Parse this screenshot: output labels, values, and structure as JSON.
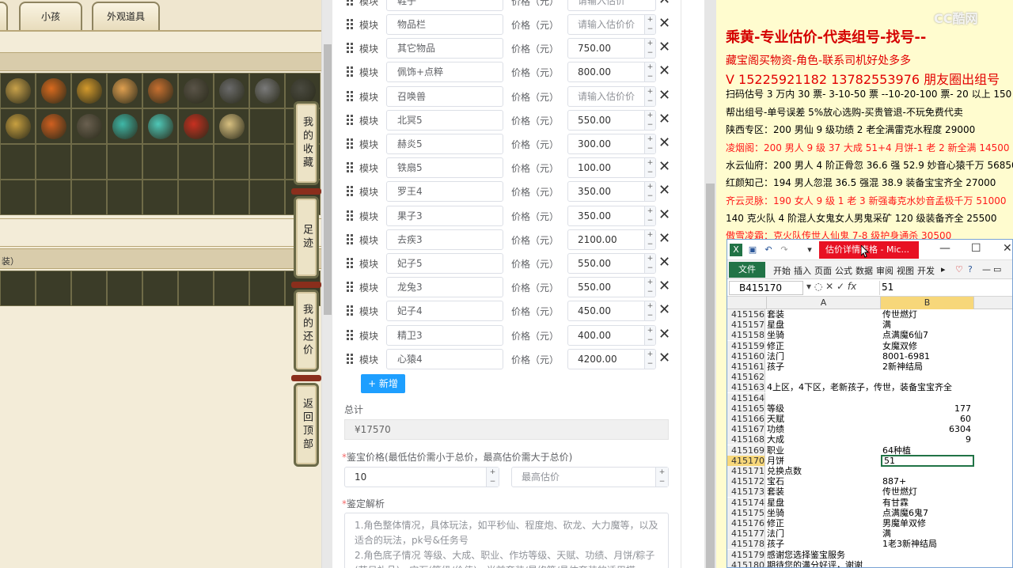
{
  "game": {
    "tabs": [
      "小孩",
      "外观道具"
    ],
    "strip_text": "装）",
    "side_buttons": [
      "我的收藏",
      "足迹",
      "我的还价",
      "返回顶部"
    ]
  },
  "form": {
    "cut_top_name": "鞋子",
    "cut_top_price": "请输入估价",
    "module_label": "模块",
    "price_label": "价格（元）",
    "rows": [
      {
        "name": "物品栏",
        "price": "请输入估价价",
        "placeholder": true
      },
      {
        "name": "其它物品",
        "price": "750.00",
        "placeholder": false
      },
      {
        "name": "佩饰+点粹",
        "price": "800.00",
        "placeholder": false
      },
      {
        "name": "召唤兽",
        "price": "请输入估价价",
        "placeholder": true
      },
      {
        "name": "北冥5",
        "price": "550.00",
        "placeholder": false
      },
      {
        "name": "赫炎5",
        "price": "300.00",
        "placeholder": false
      },
      {
        "name": "铁扇5",
        "price": "100.00",
        "placeholder": false
      },
      {
        "name": "罗王4",
        "price": "350.00",
        "placeholder": false
      },
      {
        "name": "果子3",
        "price": "350.00",
        "placeholder": false
      },
      {
        "name": "去疾3",
        "price": "2100.00",
        "placeholder": false
      },
      {
        "name": "妃子5",
        "price": "550.00",
        "placeholder": false
      },
      {
        "name": "龙兔3",
        "price": "550.00",
        "placeholder": false
      },
      {
        "name": "妃子4",
        "price": "450.00",
        "placeholder": false
      },
      {
        "name": "精卫3",
        "price": "400.00",
        "placeholder": false
      },
      {
        "name": "心猿4",
        "price": "4200.00",
        "placeholder": false
      }
    ],
    "add_button": "+ 新增",
    "total_label": "总计",
    "total_value": "¥17570",
    "jianbao_label": "鉴宝价格(最低估价需小于总价，最高估价需大于总价)",
    "min_price": "10",
    "max_placeholder": "最高估价",
    "jiexi_label": "鉴定解析",
    "jiexi_text_1": "1.角色整体情况，具体玩法，如平秒仙、程度炮、砍龙、大力魔等，以及适合的玩法，pk号&任务号",
    "jiexi_text_2": "2.角色底子情况 等级、大成、职业、作坊等级、天赋、功绩、月饼/粽子(节日礼品)、宝石(等级/价值)、当前套装/星修等/具体套装的适用搭"
  },
  "doc": {
    "line1": "乘黄-专业估价-代卖组号-找号--",
    "line2": "藏宝阁买物资-角色-联系司机好处多多",
    "line3": "V 15225921182   13782553976 朋友圈出组号",
    "line4": "扫码估号 3 万内 30 票- 3-10-50 票  --10-20-100 票- 20 以上 150",
    "line5": "帮出组号-单号误差 5%放心选购-买贵管退-不玩免费代卖",
    "line6": "陕西专区：200 男仙 9 级功绩 2 老全满雷克水程度 29000",
    "line7": "凌烟阁：200 男人 9 级 37 大成 51+4 月饼-1 老 2 新全满 14500",
    "line8": "水云仙府：200 男人 4 阶正骨忽 36.6 强 52.9 妙音心猿千万 56850",
    "line9": "红颜知己：194 男人忽混 36.5 强混 38.9 装备宝宝齐全 27000",
    "line10": "齐云灵脉：190 女人 9 级 1 老 3 新强毒克水妙音孟极千万 51000",
    "line11": "140 克火队 4 阶混人女鬼女人男鬼采矿 120 级装备齐全 25500",
    "line12": "傲雪凌霜：克火队传世人仙鬼 7-8 级护身通杀 30500",
    "watermark": "CC酷网"
  },
  "excel": {
    "title": "估价详情表格 - Mic...",
    "ribbon_file": "文件",
    "ribbon_tabs": [
      "开始",
      "插入",
      "页面",
      "公式",
      "数据",
      "审阅",
      "视图",
      "开发"
    ],
    "name_box": "B415170",
    "formula_value": "51",
    "col_a": "A",
    "col_b": "B",
    "rows": [
      {
        "n": "415156",
        "a": "套装",
        "b": "传世燃灯",
        "num": false
      },
      {
        "n": "415157",
        "a": "星盘",
        "b": "满",
        "num": false
      },
      {
        "n": "415158",
        "a": "坐骑",
        "b": "点满魔6仙7",
        "num": false
      },
      {
        "n": "415159",
        "a": "修正",
        "b": "女魔双修",
        "num": false
      },
      {
        "n": "415160",
        "a": "法门",
        "b": "8001-6981",
        "num": false
      },
      {
        "n": "415161",
        "a": "孩子",
        "b": "2新神结局",
        "num": false
      },
      {
        "n": "415162",
        "a": "",
        "b": "",
        "num": false
      },
      {
        "n": "415163",
        "a": "4上区，4下区，老新孩子，传世，装备宝宝齐全",
        "b": "",
        "num": false
      },
      {
        "n": "415164",
        "a": "",
        "b": "",
        "num": false
      },
      {
        "n": "415165",
        "a": "等级",
        "b": "177",
        "num": true
      },
      {
        "n": "415166",
        "a": "天赋",
        "b": "60",
        "num": true
      },
      {
        "n": "415167",
        "a": "功绩",
        "b": "6304",
        "num": true
      },
      {
        "n": "415168",
        "a": "大成",
        "b": "9",
        "num": true
      },
      {
        "n": "415169",
        "a": "职业",
        "b": "64种植",
        "num": false
      },
      {
        "n": "415170",
        "a": "月饼",
        "b": "51",
        "num": false,
        "selected": true
      },
      {
        "n": "415171",
        "a": "兑换点数",
        "b": "",
        "num": false
      },
      {
        "n": "415172",
        "a": "宝石",
        "b": "887+",
        "num": false
      },
      {
        "n": "415173",
        "a": "套装",
        "b": "传世燃灯",
        "num": false
      },
      {
        "n": "415174",
        "a": "星盘",
        "b": "有甘霖",
        "num": false
      },
      {
        "n": "415175",
        "a": "坐骑",
        "b": "点满魔6鬼7",
        "num": false
      },
      {
        "n": "415176",
        "a": "修正",
        "b": "男魔单双修",
        "num": false
      },
      {
        "n": "415177",
        "a": "法门",
        "b": "满",
        "num": false
      },
      {
        "n": "415178",
        "a": "孩子",
        "b": "1老3新神结局",
        "num": false
      },
      {
        "n": "415179",
        "a": "感谢您选择鉴宝服务",
        "b": "",
        "num": false
      },
      {
        "n": "415180",
        "a": "期待您的满分好评，谢谢",
        "b": "",
        "num": false
      }
    ]
  },
  "colors": {
    "accent_blue": "#1e9fff",
    "excel_green": "#217346",
    "doc_red": "#e20000",
    "doc_bg": "#fffccf"
  }
}
